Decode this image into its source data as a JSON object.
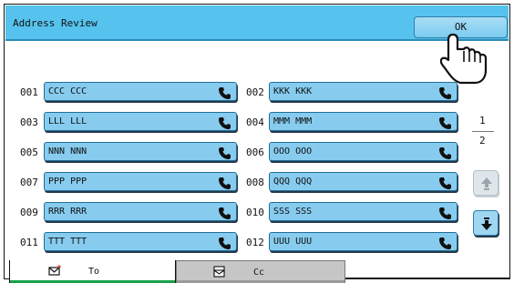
{
  "window": {
    "title": "Address Review"
  },
  "header": {
    "ok_label": "OK"
  },
  "entries": [
    {
      "number": "001",
      "name": "CCC CCC"
    },
    {
      "number": "002",
      "name": "KKK KKK"
    },
    {
      "number": "003",
      "name": "LLL LLL"
    },
    {
      "number": "004",
      "name": "MMM MMM"
    },
    {
      "number": "005",
      "name": "NNN NNN"
    },
    {
      "number": "006",
      "name": "OOO OOO"
    },
    {
      "number": "007",
      "name": "PPP PPP"
    },
    {
      "number": "008",
      "name": "QQQ QQQ"
    },
    {
      "number": "009",
      "name": "RRR RRR"
    },
    {
      "number": "010",
      "name": "SSS SSS"
    },
    {
      "number": "011",
      "name": "TTT TTT"
    },
    {
      "number": "012",
      "name": "UUU UUU"
    }
  ],
  "entry_icon": "phone-icon",
  "pagination": {
    "current": "1",
    "total": "2"
  },
  "tabs": [
    {
      "label": "To",
      "icon": "envelope-icon",
      "active": true
    },
    {
      "label": "Cc",
      "icon": "copy-envelope-icon",
      "active": false
    }
  ],
  "colors": {
    "title_bar": "#55c3ee",
    "entry_button": "#87ccef",
    "active_tab_underline": "#1aa24a"
  }
}
